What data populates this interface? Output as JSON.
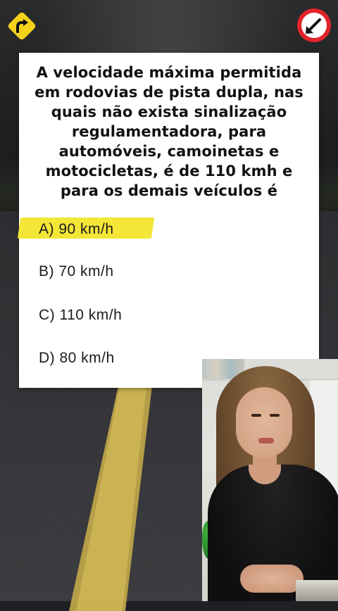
{
  "top_icons": {
    "left": "curve-right-warning-sign-icon",
    "right": "arrow-down-left-sign-icon"
  },
  "question": {
    "text": "A velocidade máxima permitida em rodovias de pista dupla, nas quais não exista sinalização regulamentadora, para automóveis, camoinetas e motocicletas, é de 110 kmh e para os demais veículos é"
  },
  "options": [
    {
      "label": "A) 90 km/h",
      "highlighted": true
    },
    {
      "label": "B) 70 km/h",
      "highlighted": false
    },
    {
      "label": "C) 110 km/h",
      "highlighted": false
    },
    {
      "label": "D) 80 km/h",
      "highlighted": false
    }
  ],
  "colors": {
    "highlight": "#f4e637",
    "card": "#ffffff",
    "sign_yellow": "#f5d31a",
    "sign_red": "#e2242a"
  }
}
